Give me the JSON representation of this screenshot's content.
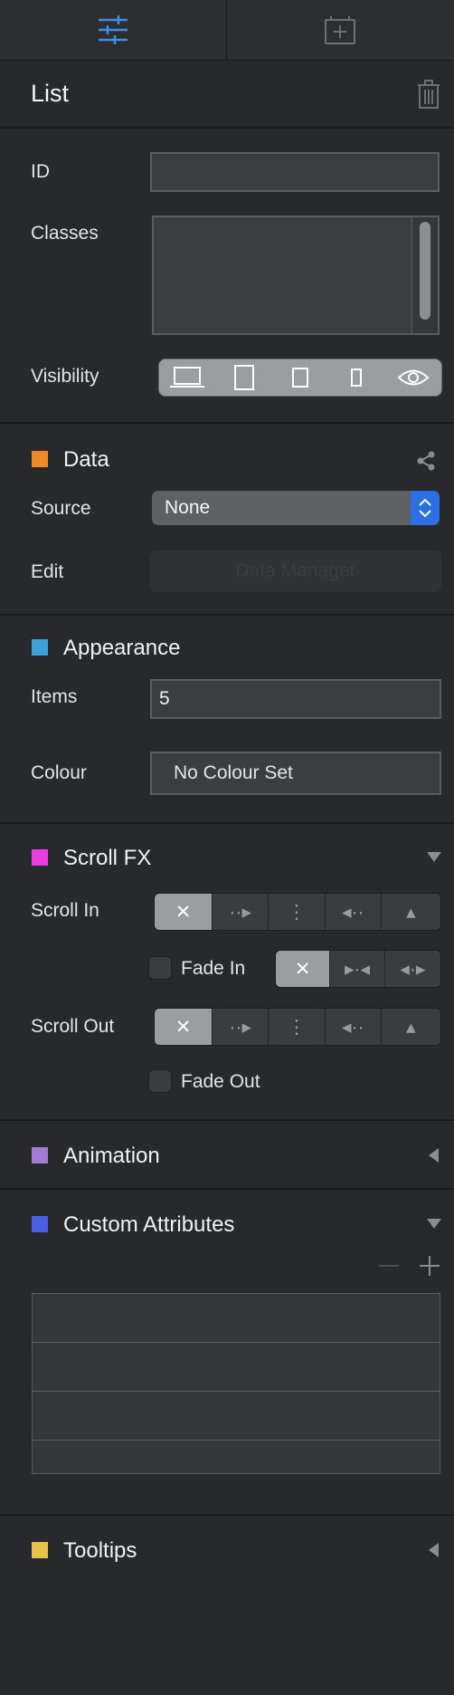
{
  "tabs": [
    {
      "name": "properties",
      "icon": "sliders-icon"
    },
    {
      "name": "add",
      "icon": "add-component-icon"
    }
  ],
  "header": {
    "title": "List"
  },
  "general": {
    "id_label": "ID",
    "id_value": "",
    "classes_label": "Classes",
    "visibility_label": "Visibility",
    "visibility_options": [
      "desktop",
      "tablet-landscape",
      "tablet-portrait",
      "phone",
      "visible"
    ]
  },
  "data_section": {
    "title": "Data",
    "color": "#f08a24",
    "source_label": "Source",
    "source_value": "None",
    "edit_label": "Edit",
    "edit_button": "Data Manager"
  },
  "appearance": {
    "title": "Appearance",
    "color": "#3da0d6",
    "items_label": "Items",
    "items_value": "5",
    "colour_label": "Colour",
    "colour_value": "No Colour Set"
  },
  "scroll_fx": {
    "title": "Scroll FX",
    "color": "#e63ee0",
    "scroll_in_label": "Scroll In",
    "fade_in_label": "Fade In",
    "scroll_out_label": "Scroll Out",
    "fade_out_label": "Fade Out"
  },
  "animation": {
    "title": "Animation",
    "color": "#a57ad6"
  },
  "custom_attributes": {
    "title": "Custom Attributes",
    "color": "#4a5fe0",
    "rows": 4
  },
  "tooltips": {
    "title": "Tooltips",
    "color": "#e8c14a"
  }
}
